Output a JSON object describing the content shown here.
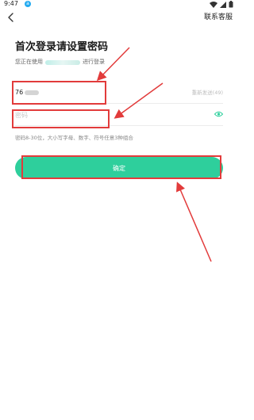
{
  "status_bar": {
    "time": "9:47",
    "app_badge": "a"
  },
  "nav": {
    "contact_label": "联系客服"
  },
  "header": {
    "title": "首次登录请设置密码",
    "subtitle_prefix": "您正在使用",
    "subtitle_suffix": "进行登录"
  },
  "form": {
    "code_value": "76",
    "resend_label": "重新发送(49)",
    "password_placeholder": "密码",
    "hint": "密码8-30位，大小写字母、数字、符号任意3种组合",
    "confirm_label": "确定"
  },
  "colors": {
    "accent": "#2ecf9c",
    "annotation": "#e23b3b"
  }
}
